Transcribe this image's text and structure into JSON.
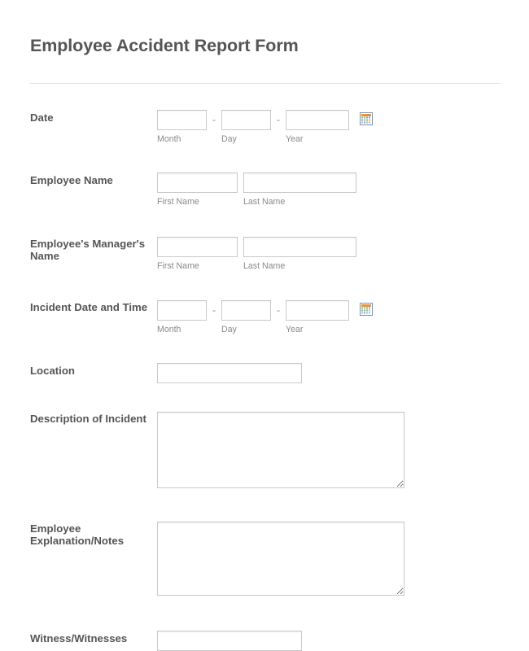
{
  "form": {
    "title": "Employee Accident Report Form",
    "fields": {
      "date": {
        "label": "Date",
        "month_placeholder": "",
        "day_placeholder": "",
        "year_placeholder": "",
        "month_value": "",
        "day_value": "",
        "year_value": "",
        "month_sublabel": "Month",
        "day_sublabel": "Day",
        "year_sublabel": "Year",
        "separator": "-",
        "calendar_icon": "calendar-icon"
      },
      "employee_name": {
        "label": "Employee Name",
        "first_value": "",
        "last_value": "",
        "first_sublabel": "First Name",
        "last_sublabel": "Last Name"
      },
      "manager_name": {
        "label": "Employee's Manager's Name",
        "first_value": "",
        "last_value": "",
        "first_sublabel": "First Name",
        "last_sublabel": "Last Name"
      },
      "incident_datetime": {
        "label": "Incident Date and Time",
        "month_value": "",
        "day_value": "",
        "year_value": "",
        "month_sublabel": "Month",
        "day_sublabel": "Day",
        "year_sublabel": "Year",
        "separator": "-",
        "calendar_icon": "calendar-icon"
      },
      "location": {
        "label": "Location",
        "value": ""
      },
      "description": {
        "label": "Description of Incident",
        "value": ""
      },
      "notes": {
        "label": "Employee Explanation/Notes",
        "value": ""
      },
      "witness": {
        "label": "Witness/Witnesses",
        "value": ""
      }
    },
    "colors": {
      "label_text": "#555555",
      "sublabel_text": "#8a8a8a",
      "input_border": "#c9c9c9",
      "divider": "#e2e2e2",
      "page_background": "#ffffff",
      "calendar_icon_frame": "#6f93c4",
      "calendar_icon_header": "#f0922b"
    }
  }
}
